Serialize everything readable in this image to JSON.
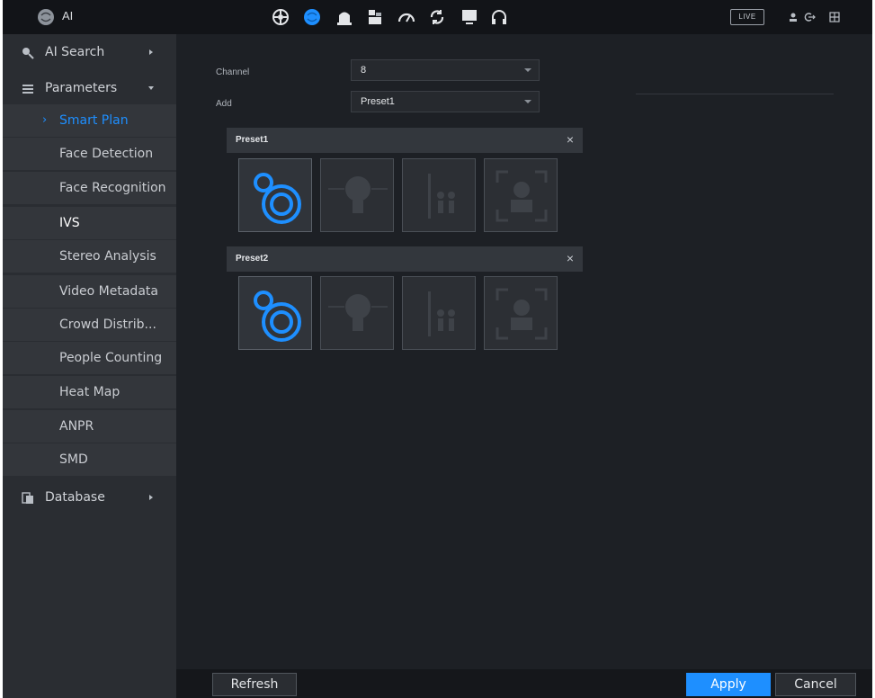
{
  "header": {
    "title": "AI",
    "nav_icons": [
      "ai-module-icon",
      "ai-brain-icon",
      "alarm-icon",
      "storage-icon",
      "performance-icon",
      "backup-icon",
      "display-icon",
      "audio-icon"
    ],
    "live_label": "LIVE",
    "right_icons": [
      "user-icon",
      "logout-icon",
      "grid-icon"
    ]
  },
  "sidebar": {
    "ai_search": "AI Search",
    "parameters": "Parameters",
    "items": [
      {
        "label": "Smart Plan",
        "active": true
      },
      {
        "label": "Face Detection"
      },
      {
        "label": "Face Recognition"
      },
      {
        "label": "IVS"
      },
      {
        "label": "Stereo Analysis"
      },
      {
        "label": "Video Metadata"
      },
      {
        "label": "Crowd Distrib..."
      },
      {
        "label": "People Counting"
      },
      {
        "label": "Heat Map"
      },
      {
        "label": "ANPR"
      },
      {
        "label": "SMD"
      }
    ],
    "database": "Database"
  },
  "form": {
    "channel_label": "Channel",
    "channel_value": "8",
    "add_label": "Add",
    "add_value": "Preset1"
  },
  "presets": [
    {
      "name": "Preset1",
      "close": "×",
      "plans": [
        "smart-tracking-icon",
        "face-detection-icon",
        "people-counting-icon",
        "face-recognition-icon"
      ]
    },
    {
      "name": "Preset2",
      "close": "×",
      "plans": [
        "smart-tracking-icon",
        "face-detection-icon",
        "people-counting-icon",
        "face-recognition-icon"
      ]
    }
  ],
  "footer": {
    "refresh": "Refresh",
    "apply": "Apply",
    "cancel": "Cancel"
  },
  "colors": {
    "accent": "#1e8fff",
    "background": "#1d2025",
    "sidebar": "#2a2d32"
  }
}
